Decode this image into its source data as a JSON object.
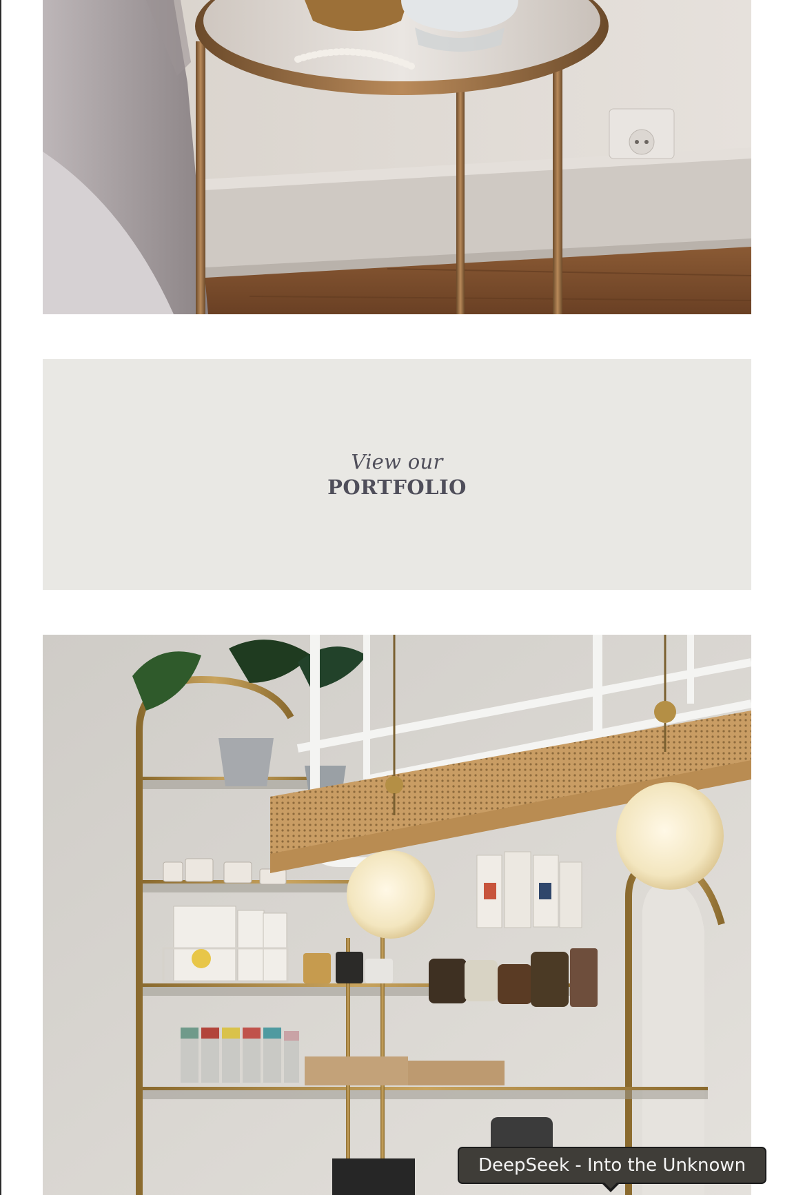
{
  "images": {
    "top": {
      "alt": "Gold side table with mirrored glass top beside a bed"
    },
    "bottom": {
      "alt": "Cafe interior with gold shelving, rattan ceiling shelf and globe pendant lamps"
    }
  },
  "portfolio": {
    "kicker": "View our",
    "title": "PORTFOLIO"
  },
  "tooltip": {
    "text": "DeepSeek - Into the Unknown"
  },
  "colors": {
    "card_background": "#e9e8e4",
    "card_text": "#4f4e5a",
    "tooltip_background": "#3f3d38"
  }
}
